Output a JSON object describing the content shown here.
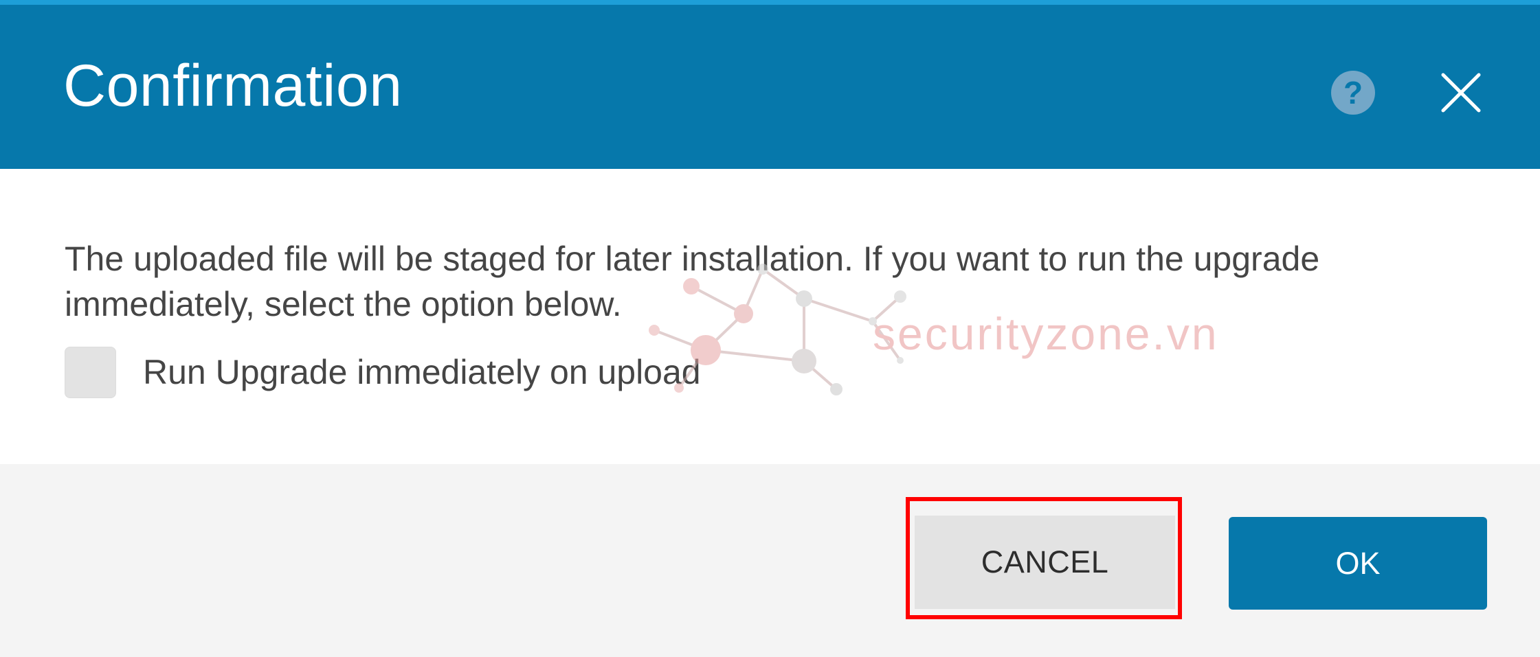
{
  "dialog": {
    "title": "Confirmation",
    "help_icon": "help-icon",
    "help_glyph": "?",
    "close_icon": "close-icon"
  },
  "body": {
    "message": "The uploaded file will be staged for later installation. If you want to run the upgrade immediately, select the option below.",
    "checkbox_label": "Run Upgrade immediately on upload",
    "checkbox_checked": false
  },
  "footer": {
    "cancel_label": "CANCEL",
    "ok_label": "OK"
  },
  "watermark": {
    "text": "securityzone.vn",
    "icon": "network-logo-icon"
  },
  "colors": {
    "header": "#0678ab",
    "accent_strip": "#1d9fd8",
    "ok_button": "#0678ab",
    "highlight": "#ff0000"
  }
}
